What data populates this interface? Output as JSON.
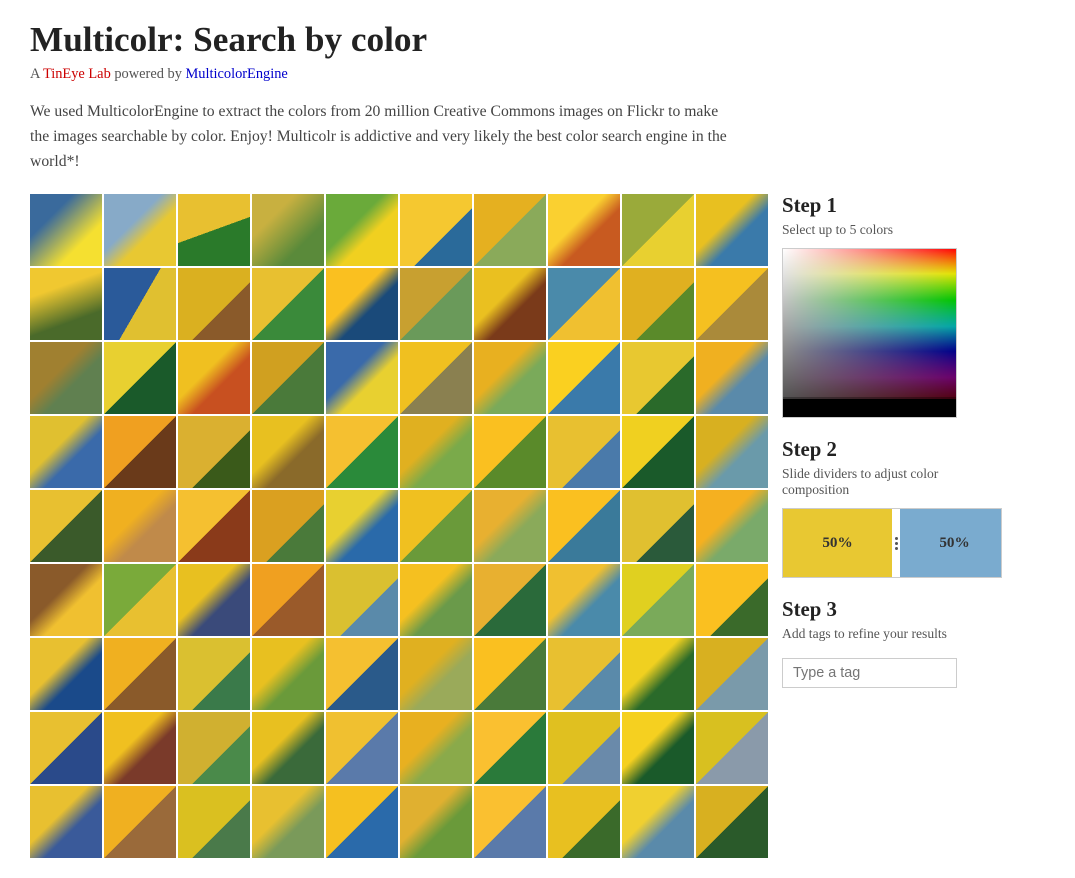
{
  "header": {
    "title": "Multicolr: Search by color",
    "subtitle_prefix": "A ",
    "subtitle_brand": "TinEye Lab",
    "subtitle_mid": " powered by ",
    "subtitle_engine": "MulticolorEngine"
  },
  "description": "We used MulticolorEngine to extract the colors from 20 million Creative Commons images on Flickr to make the images searchable by color. Enjoy! Multicolr is addictive and very likely the best color search engine in the world*!",
  "step1": {
    "title": "Step 1",
    "description": "Select up to 5 colors"
  },
  "step2": {
    "title": "Step 2",
    "description": "Slide dividers to adjust color composition",
    "bar1_label": "50%",
    "bar2_label": "50%",
    "bar1_color": "#e8c832",
    "bar2_color": "#7aabcf"
  },
  "step3": {
    "title": "Step 3",
    "description": "Add tags to refine your results",
    "tag_placeholder": "Type a tag"
  }
}
